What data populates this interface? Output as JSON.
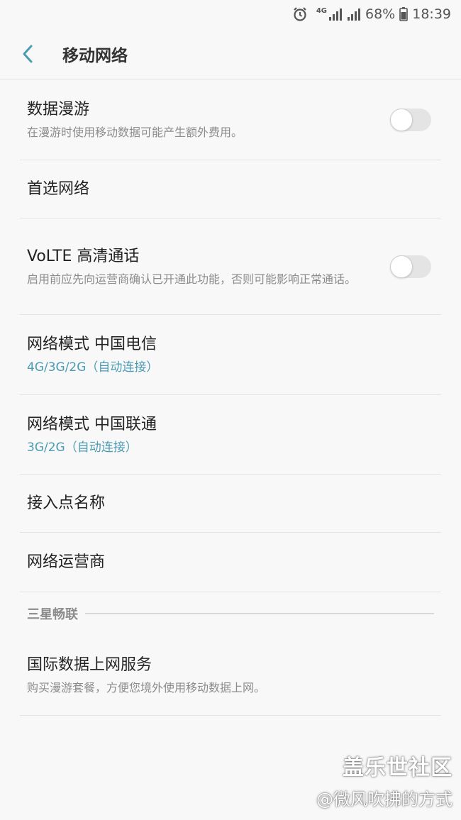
{
  "status_bar": {
    "network_type": "4G",
    "battery_percent": "68%",
    "time": "18:39",
    "icons": [
      "alarm-icon",
      "signal-icon",
      "signal-icon",
      "battery-icon"
    ]
  },
  "header": {
    "back_icon": "chevron-left-icon",
    "title": "移动网络"
  },
  "settings": {
    "data_roaming": {
      "title": "数据漫游",
      "subtitle": "在漫游时使用移动数据可能产生额外费用。",
      "toggle_on": false
    },
    "preferred_network": {
      "title": "首选网络"
    },
    "volte": {
      "title": "VoLTE 高清通话",
      "subtitle": "启用前应先向运营商确认已开通此功能，否则可能影响正常通话。",
      "toggle_on": false
    },
    "network_mode_telecom": {
      "title": "网络模式 中国电信",
      "subtitle": "4G/3G/2G（自动连接）"
    },
    "network_mode_unicom": {
      "title": "网络模式 中国联通",
      "subtitle": "3G/2G（自动连接）"
    },
    "apn": {
      "title": "接入点名称"
    },
    "network_operator": {
      "title": "网络运营商"
    },
    "section_samsung": {
      "label": "三星畅联"
    },
    "intl_data": {
      "title": "国际数据上网服务",
      "subtitle": "购买漫游套餐，方便您境外使用移动数据上网。"
    }
  },
  "watermark": {
    "line1": "盖乐世社区",
    "line2": "@微风吹拂的方式"
  },
  "colors": {
    "accent": "#4a9bb3",
    "background": "#f8f8f8",
    "toggle_track": "#e4e4e4"
  }
}
